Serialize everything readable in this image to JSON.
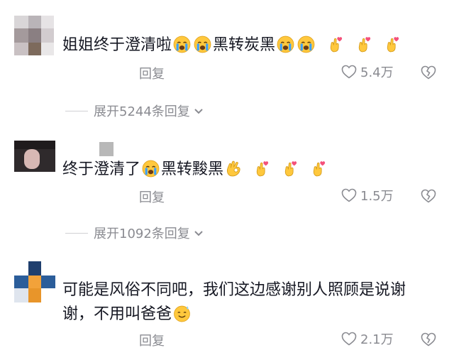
{
  "comments": [
    {
      "text_parts": [
        "姐姐终于澄清啦",
        "黑转炭黑"
      ],
      "reply_label": "回复",
      "likes": "5.4万",
      "expand_label": "展开5244条回复"
    },
    {
      "text_parts": [
        "终于澄清了",
        "黑转黢黑"
      ],
      "reply_label": "回复",
      "likes": "1.5万",
      "expand_label": "展开1092条回复"
    },
    {
      "text_line1": "可能是风俗不同吧，我们这边感谢别人照顾是说谢",
      "text_line2": "谢，不用叫爸爸",
      "reply_label": "回复",
      "likes": "2.1万"
    }
  ],
  "icons": [
    "crying-emoji",
    "crossed-fingers-heart-emoji",
    "ok-hand-emoji",
    "sweat-smile-emoji",
    "heart-outline-icon",
    "broken-heart-icon",
    "chevron-down-icon"
  ],
  "colors": {
    "text": "#161823",
    "secondary": "#8a8b91",
    "emoji_yellow": "#ffc83d",
    "heart_pink": "#f4517a"
  }
}
